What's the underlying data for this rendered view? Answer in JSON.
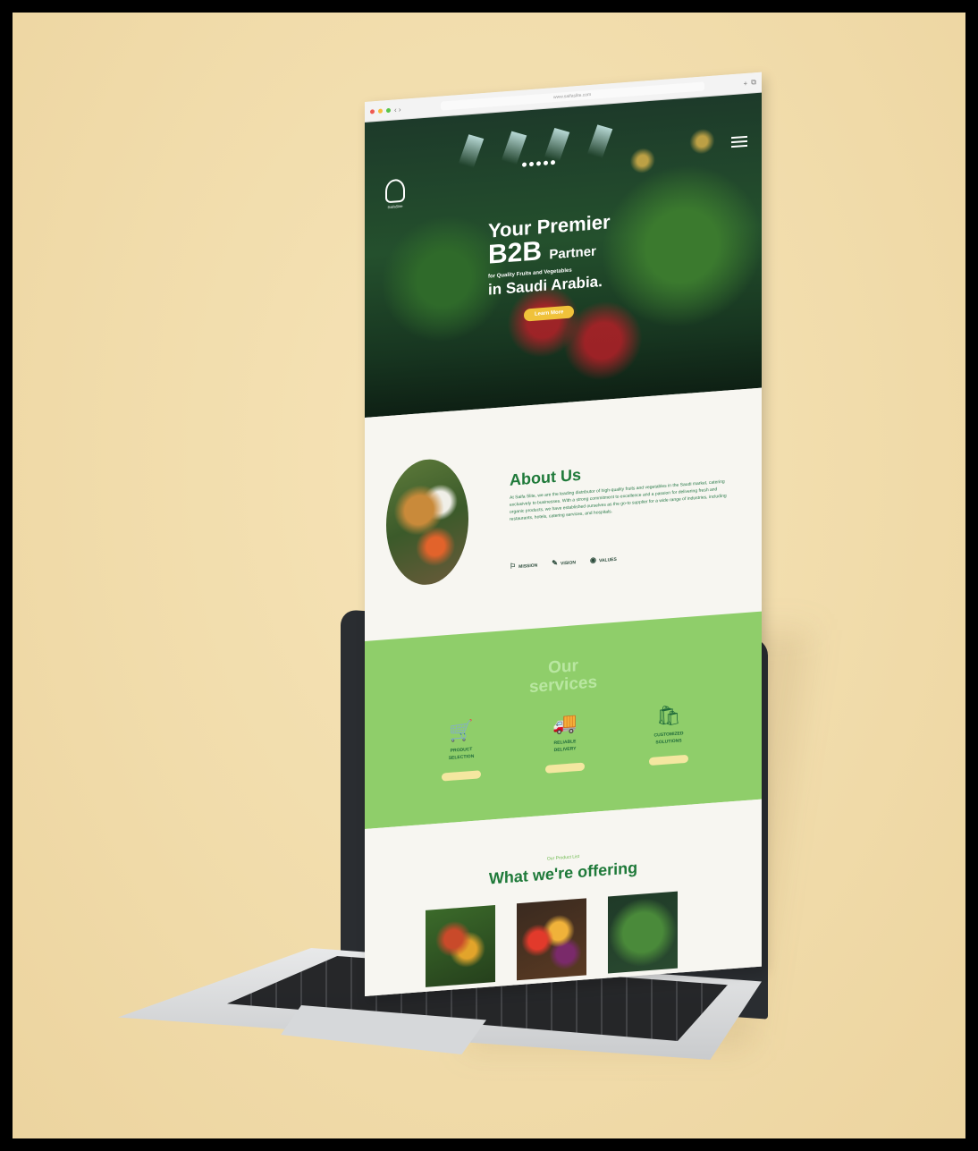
{
  "browser": {
    "url": "www.saifaslite.com",
    "nav_back_forward": "‹ ›",
    "plus_icon": "+",
    "tabs_icon": "⧉"
  },
  "hero": {
    "logo_text": "SaifaSlite",
    "line1": "Your Premier",
    "line2_big": "B2B",
    "line2_rest": "Partner",
    "line3_small": "for Quality Fruits and Vegetables",
    "line4": "in Saudi Arabia.",
    "cta_label": "Learn More"
  },
  "about": {
    "title": "About Us",
    "body": "At Saifa Slite, we are the leading distributor of high-quality fruits and vegetables in the Saudi market, catering exclusively to businesses. With a strong commitment to excellence and a passion for delivering fresh and organic products, we have established ourselves as the go-to supplier for a wide range of industries, including restaurants, hotels, catering services, and hospitals.",
    "tabs": [
      {
        "icon": "⚐",
        "label": "MISSION"
      },
      {
        "icon": "✎",
        "label": "VISION"
      },
      {
        "icon": "◉",
        "label": "VALUES"
      }
    ]
  },
  "services": {
    "title_line1": "Our",
    "title_line2": "services",
    "items": [
      {
        "icon": "🛒",
        "label_line1": "PRODUCT",
        "label_line2": "SELECTION"
      },
      {
        "icon": "🚚",
        "label_line1": "RELIABLE",
        "label_line2": "DELIVERY"
      },
      {
        "icon": "🛍",
        "label_line1": "CUSTOMIZED",
        "label_line2": "SOLUTIONS"
      }
    ]
  },
  "offering": {
    "subtitle": "Our Product List",
    "title": "What we're offering"
  }
}
